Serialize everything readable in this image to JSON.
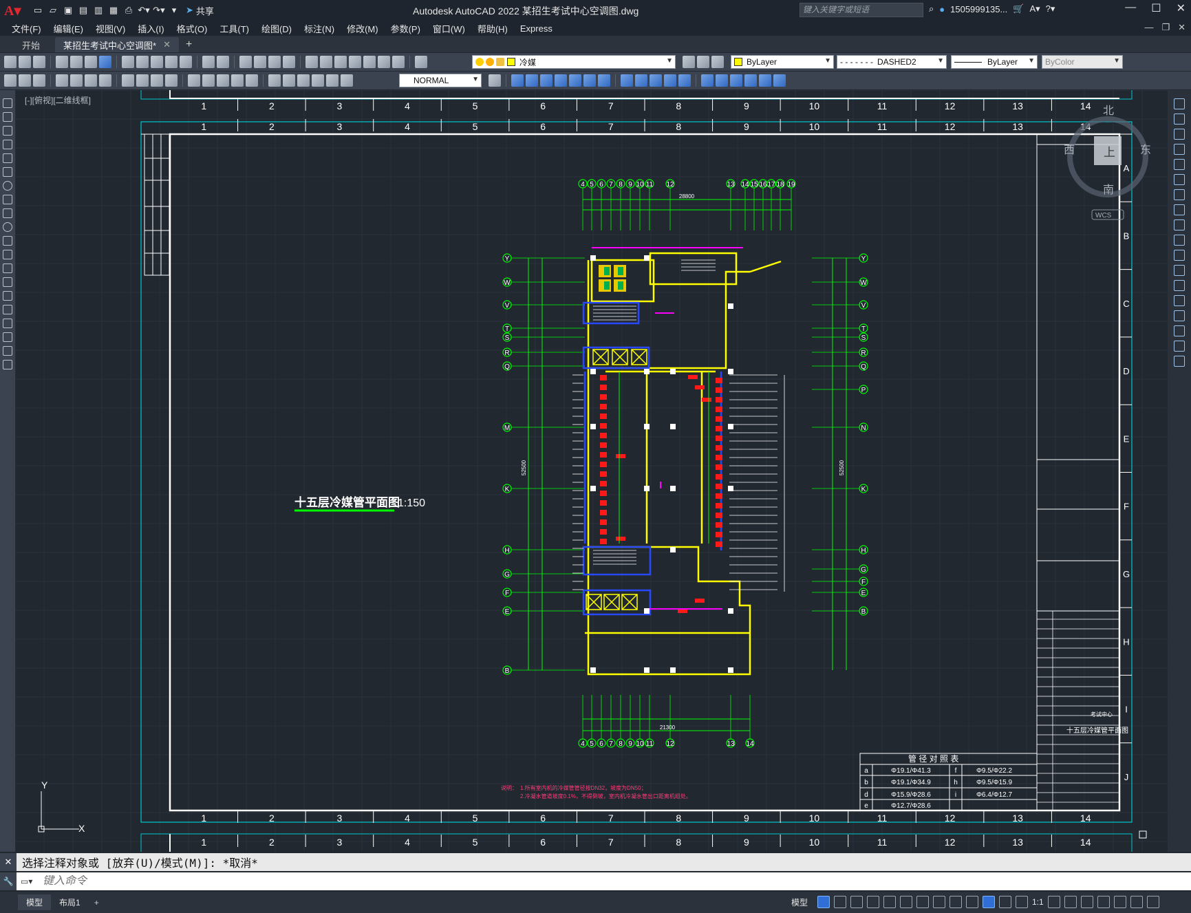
{
  "titlebar": {
    "share_label": "共享",
    "app_title": "Autodesk AutoCAD 2022    某招生考试中心空调图.dwg",
    "search_placeholder": "键入关键字或短语",
    "user": "1505999135...",
    "window_controls": [
      "minimize-icon",
      "maximize-icon",
      "close-icon"
    ]
  },
  "menubar": {
    "items": [
      "文件(F)",
      "编辑(E)",
      "视图(V)",
      "插入(I)",
      "格式(O)",
      "工具(T)",
      "绘图(D)",
      "标注(N)",
      "修改(M)",
      "参数(P)",
      "窗口(W)",
      "帮助(H)",
      "Express"
    ]
  },
  "tabs": {
    "start": "开始",
    "active": "某招生考试中心空调图*"
  },
  "toolbar": {
    "layer_name": "冷媒",
    "color": "ByLayer",
    "linetype": "DASHED2",
    "lineweight": "ByLayer",
    "plotstyle": "ByColor",
    "text_style": "NORMAL"
  },
  "viewport_label": "[-][俯视][二维线框]",
  "viewcube": {
    "north": "北",
    "south": "南",
    "east": "东",
    "west": "西",
    "top": "上",
    "wcs": "WCS"
  },
  "drawing": {
    "title": "十五层冷媒管平面图",
    "scale": "1:150",
    "grid_numbers": [
      "1",
      "2",
      "3",
      "4",
      "5",
      "6",
      "7",
      "8",
      "9",
      "10",
      "11",
      "12",
      "13",
      "14"
    ],
    "grid_letters": [
      "A",
      "B",
      "C",
      "D",
      "E",
      "F",
      "G",
      "H",
      "I",
      "J"
    ],
    "top_axis_labels": [
      "4",
      "5",
      "6",
      "7",
      "8",
      "9",
      "10",
      "11",
      "12",
      "13",
      "14",
      "15",
      "16",
      "17",
      "18",
      "19"
    ],
    "bottom_axis_labels": [
      "4",
      "5",
      "6",
      "7",
      "8",
      "9",
      "10",
      "11",
      "12",
      "13",
      "14"
    ],
    "left_axis_labels": [
      "Y",
      "W",
      "V",
      "T",
      "S",
      "R",
      "Q",
      "M",
      "K",
      "H",
      "G",
      "F",
      "E",
      "B"
    ],
    "right_axis_labels": [
      "Y",
      "W",
      "V",
      "T",
      "S",
      "R",
      "Q",
      "P",
      "N",
      "K",
      "H",
      "G",
      "F",
      "E",
      "B"
    ],
    "dim_top": "28800",
    "dim_bottom": "21300",
    "dim_side": "52500",
    "pipe_table_title": "管 径 对 照 表",
    "pipe_table": [
      [
        "a",
        "Φ19.1/Φ41.3",
        "f",
        "Φ9.5/Φ22.2"
      ],
      [
        "b",
        "Φ19.1/Φ34.9",
        "h",
        "Φ9.5/Φ15.9"
      ],
      [
        "d",
        "Φ15.9/Φ28.6",
        "i",
        "Φ6.4/Φ12.7"
      ],
      [
        "e",
        "Φ12.7/Φ28.6",
        "",
        ""
      ]
    ],
    "notes_label": "说明：",
    "note_1": "1.所有室内机的冷媒管管径按DN32，坡度为DN50；",
    "note_2": "2.冷凝水管道坡度0.1%，不得倒坡，室内机冷凝水管出口距离机组处。",
    "titleblock_drawing_name": "十五层冷媒管平面图",
    "titleblock_project": "考试中心"
  },
  "command": {
    "history": "选择注释对象或 [放弃(U)/模式(M)]: *取消*",
    "placeholder": "键入命令"
  },
  "statusbar": {
    "layout_tabs": [
      "模型",
      "布局1"
    ],
    "model_label": "模型",
    "scale": "1:1"
  },
  "colors": {
    "background": "#212830",
    "frame_cyan": "#00c8d0",
    "wall_yellow": "#ffff00",
    "axis_green": "#00ff00",
    "unit_red": "#ff0000",
    "duct_blue": "#0000ff",
    "magenta": "#ff00ff"
  }
}
